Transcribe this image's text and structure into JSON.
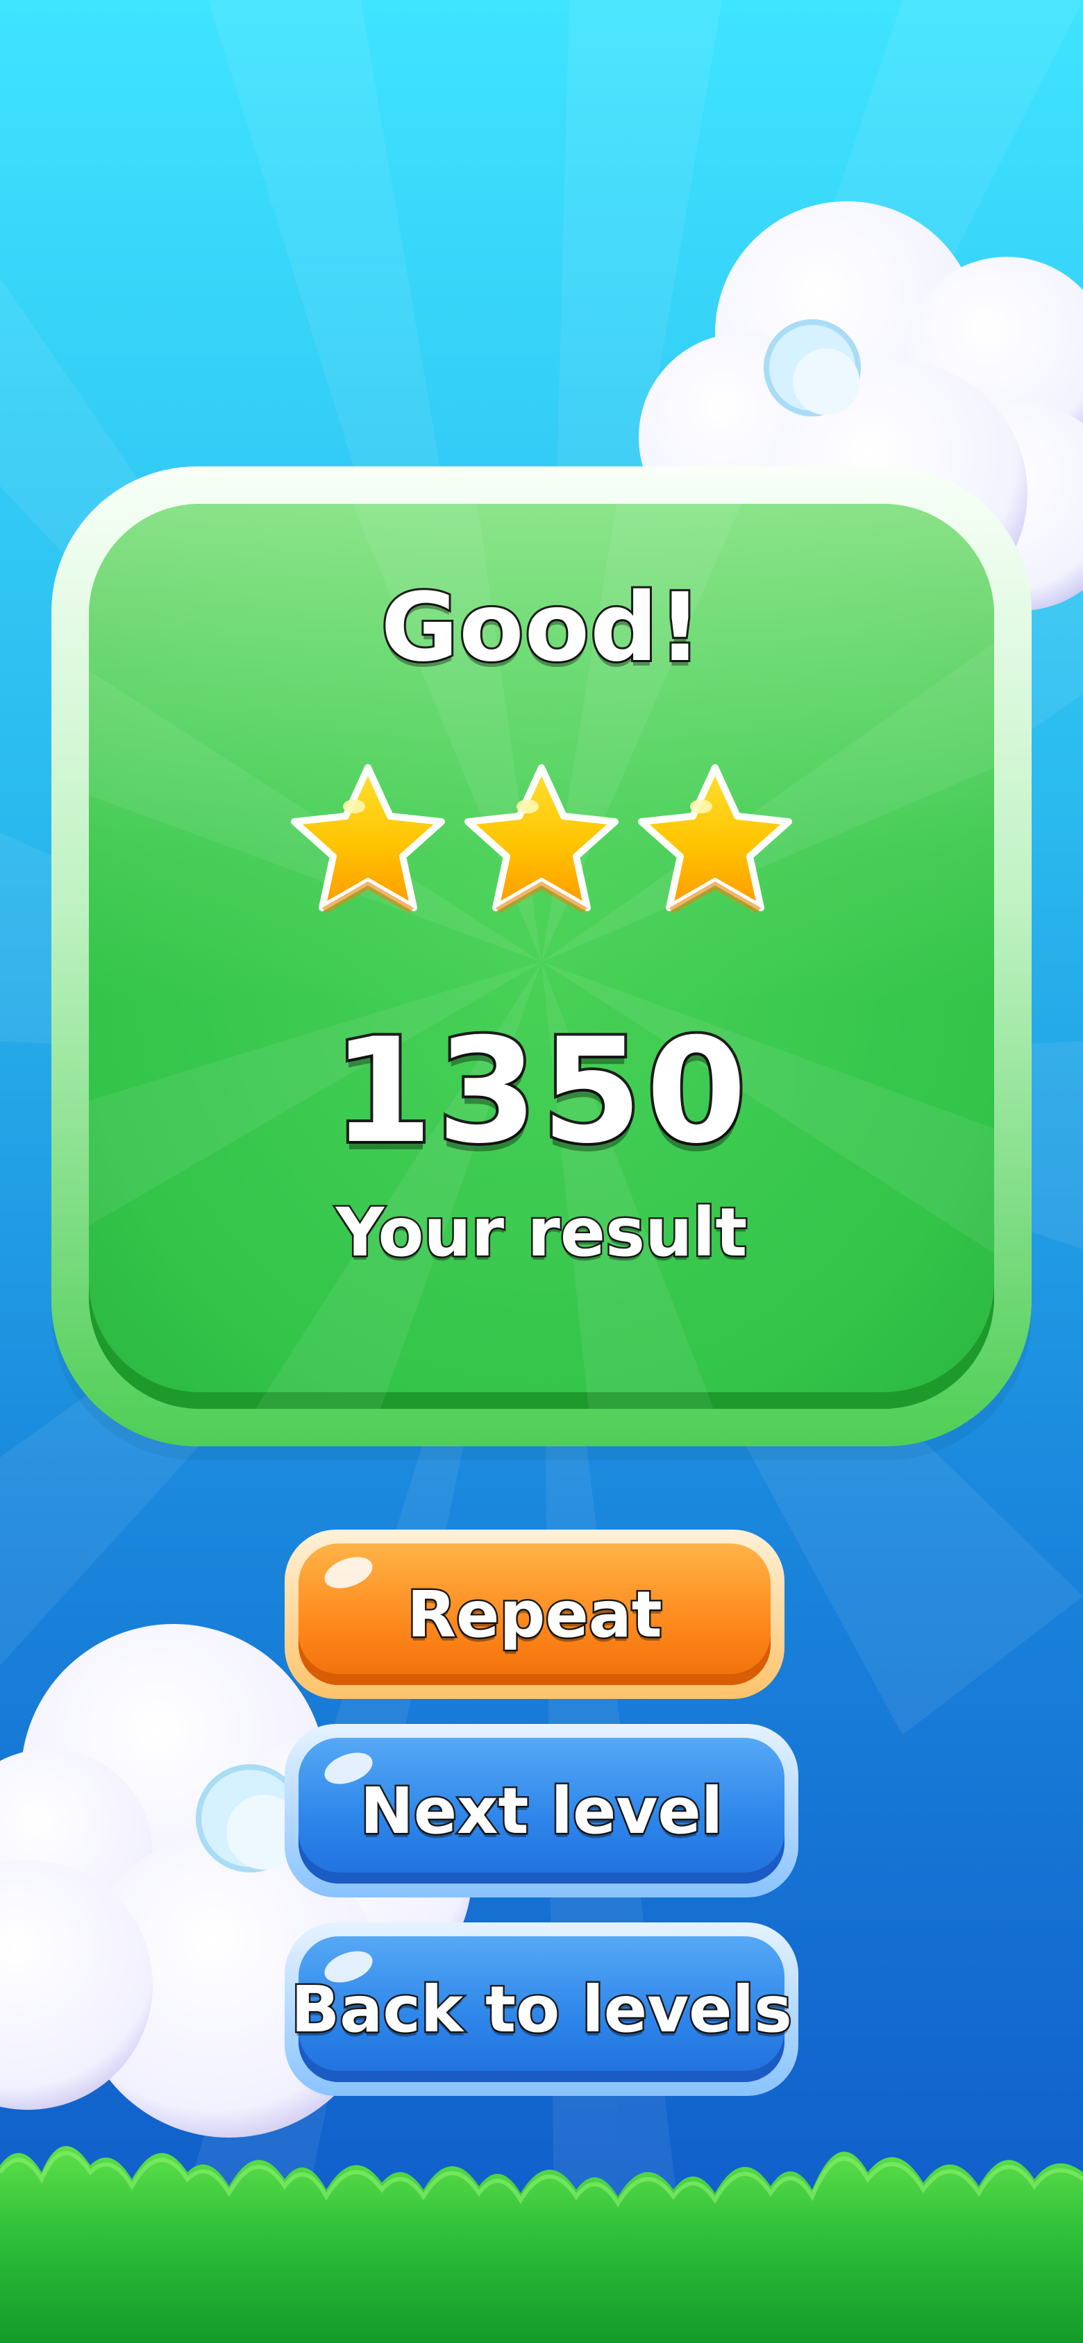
{
  "result": {
    "title": "Good!",
    "stars_earned": 3,
    "stars_total": 3,
    "score": "1350",
    "score_label": "Your result"
  },
  "buttons": {
    "repeat": "Repeat",
    "next_level": "Next level",
    "back_to_levels": "Back to levels"
  },
  "colors": {
    "sky_top": "#3fe4ff",
    "sky_bottom": "#0f57c7",
    "panel_green": "#33c44a",
    "star_gold": "#ffc400",
    "button_orange": "#ff8a1e",
    "button_blue": "#2e86ea",
    "grass_green": "#2fbf3a"
  },
  "icons": {
    "star": "star-icon",
    "cloud": "cloud-decoration",
    "grass": "grass-decoration"
  }
}
